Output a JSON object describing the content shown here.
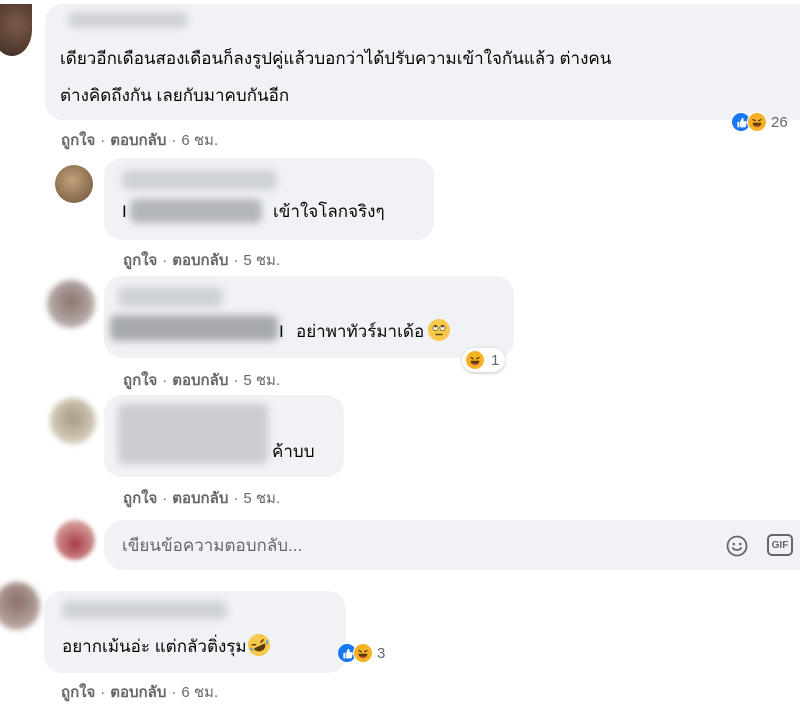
{
  "comments": [
    {
      "text_line1": "เดียวอีกเดือนสองเดือนก็ลงรูปคู่แล้วบอกว่าได้ปรับความเข้าใจกันแล้ว ต่างคน",
      "text_line2": "ต่างคิดถึงกัน เลยกับมาคบกันอีก",
      "like_label": "ถูกใจ",
      "reply_label": "ตอบกลับ",
      "time": "6 ชม.",
      "reaction_count": "26"
    },
    {
      "prefix": "I",
      "text": "เข้าใจโลกจริงๆ",
      "like_label": "ถูกใจ",
      "reply_label": "ตอบกลับ",
      "time": "5 ชม."
    },
    {
      "prefix": "I",
      "text": "อย่าพาทัวร์มาเด้อ",
      "like_label": "ถูกใจ",
      "reply_label": "ตอบกลับ",
      "time": "5 ชม.",
      "reaction_count": "1"
    },
    {
      "text": "ค้าบบ",
      "like_label": "ถูกใจ",
      "reply_label": "ตอบกลับ",
      "time": "5 ชม."
    },
    {
      "text": "อยากเม้นอ่ะ แต่กลัวติ่งรุม",
      "like_label": "ถูกใจ",
      "reply_label": "ตอบกลับ",
      "time": "6 ชม.",
      "reaction_count": "3"
    }
  ],
  "reply_box": {
    "placeholder": "เขียนข้อความตอบกลับ...",
    "gif_label": "GIF"
  },
  "icons": {
    "like": "like-reaction-icon",
    "haha": "haha-reaction-icon",
    "rolling_eyes": "rolling-eyes-emoji",
    "rofl": "rofl-emoji",
    "smiley": "emoji-picker-icon",
    "gif": "gif-icon"
  },
  "colors": {
    "bubble": "#f0f2f5",
    "meta_text": "#65676b",
    "like_blue": "#1877f2",
    "haha_yellow": "#f7b125"
  }
}
